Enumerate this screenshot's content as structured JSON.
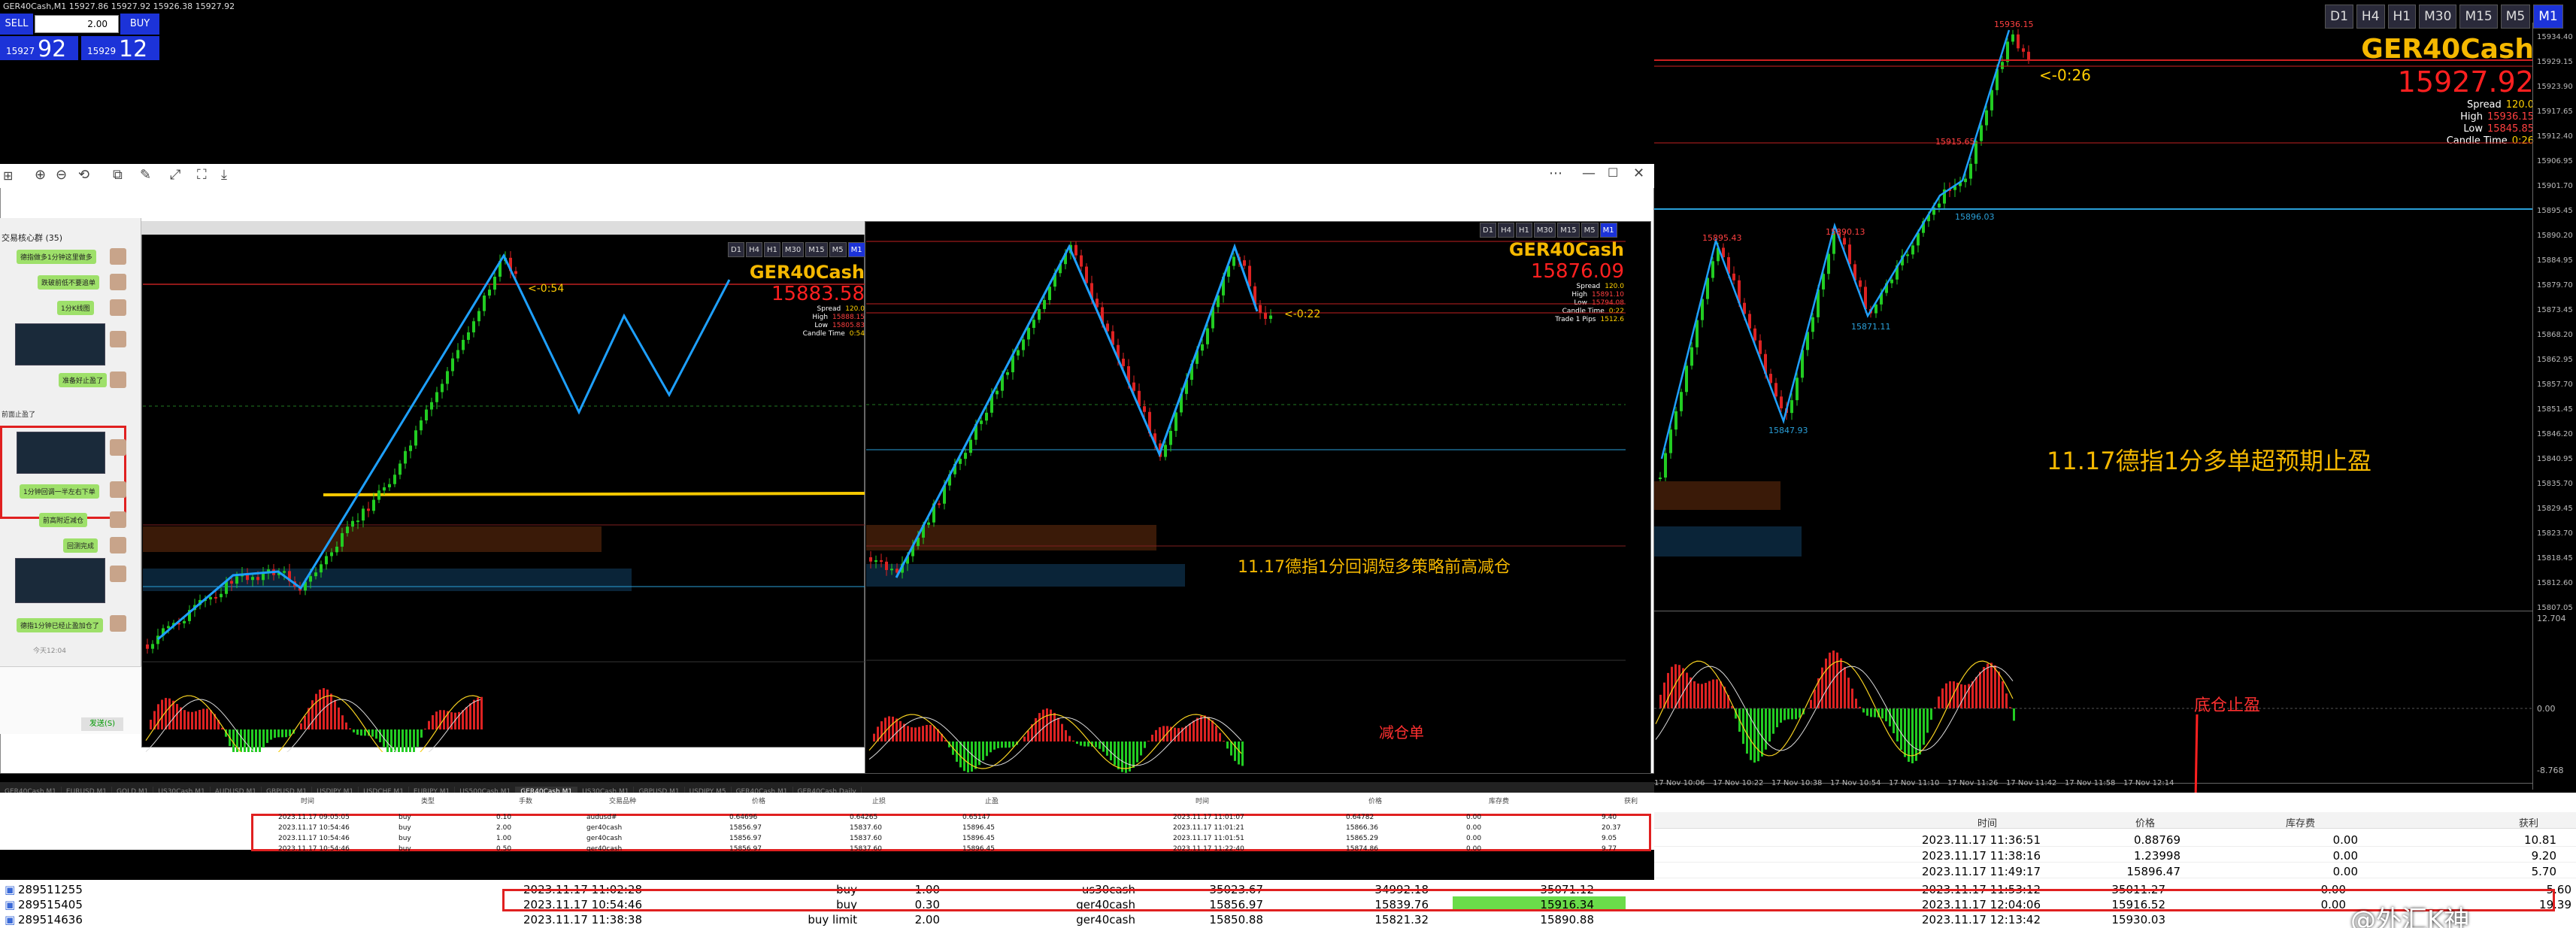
{
  "main_chart": {
    "window_title": "GER40Cash,M1  15927.86 15927.92 15926.38 15927.92",
    "timeframes": [
      "D1",
      "H4",
      "H1",
      "M30",
      "M15",
      "M5",
      "M1"
    ],
    "selected_tf": "M1",
    "symbol": "GER40Cash",
    "price": "15927.92",
    "spread_label": "Spread",
    "spread": "120.0",
    "high_label": "High",
    "high": "15936.15",
    "low_label": "Low",
    "low": "15845.85",
    "candle_label": "Candle Time",
    "candle_time": "0:26",
    "cursor_label": "<-0:26",
    "annotation": "11.17德指1分多单超预期止盈",
    "bottom_note": "底仓止盈",
    "label_peak": "15936.15",
    "label_a": "15895.43",
    "label_b": "15890.13",
    "label_c": "15847.93",
    "label_d": "15871.11",
    "label_e": "15896.03",
    "label_f": "15915.65",
    "y_ticks": [
      "15934.40",
      "15929.15",
      "15923.90",
      "15917.65",
      "15912.40",
      "15906.95",
      "15901.70",
      "15895.45",
      "15890.20",
      "15884.95",
      "15879.70",
      "15873.45",
      "15868.20",
      "15862.95",
      "15857.70",
      "15851.45",
      "15846.20",
      "15840.95",
      "15835.70",
      "15829.45",
      "15823.70",
      "15818.45",
      "15812.60",
      "15807.05"
    ],
    "osc_ticks": [
      "12.704",
      "0.00",
      "-8.768"
    ],
    "x_ticks": [
      "17 Nov 10:06",
      "17 Nov 10:22",
      "17 Nov 10:38",
      "17 Nov 10:54",
      "17 Nov 11:10",
      "17 Nov 11:26",
      "17 Nov 11:42",
      "17 Nov 11:58",
      "17 Nov 12:14"
    ]
  },
  "trade_panel": {
    "sell": "SELL",
    "buy": "BUY",
    "lot": "2.00",
    "sell_small": "15927",
    "sell_big": "92",
    "buy_small": "15929",
    "buy_big": "12"
  },
  "window2": {
    "symbol": "GER40Cash",
    "price": "15883.58",
    "spread": "120.0",
    "high": "15888.15",
    "low": "15805.83",
    "candle": "0:54",
    "cursor": "<-0:54",
    "timeframes": [
      "D1",
      "H4",
      "H1",
      "M30",
      "M15",
      "M5",
      "M1"
    ]
  },
  "window3": {
    "symbol": "GER40Cash",
    "price": "15876.09",
    "spread": "120.0",
    "high": "15891.10",
    "low": "15794.08",
    "candle_time_label": "Candle Time",
    "candle": "0:22",
    "trade_label": "Trade 1 Pips",
    "trade_val": "1512.6",
    "cursor": "<-0:22",
    "annotation": "11.17德指1分回调短多策略前高减仓",
    "note": "减仓单",
    "timeframes": [
      "D1",
      "H4",
      "H1",
      "M30",
      "M15",
      "M5",
      "M1"
    ]
  },
  "chat": {
    "title": "交易核心群 (35)",
    "messages": [
      "德指做多1分钟这里做多",
      "跌破前低不要追单",
      "1分K线图",
      "准备好止盈了",
      "1分钟回调一半左右下单",
      "前高附近减仓",
      "回测完成",
      "德指1分钟已经止盈加仓了"
    ],
    "status": "今天12:04",
    "side_text": "前面止盈了",
    "send": "发送(S)"
  },
  "symbol_tabs": [
    "GER40Cash,M1",
    "EURUSD,M1",
    "GOLD,M1",
    "US30Cash,M1",
    "AUDUSD,M1",
    "GBPUSD,M1",
    "USDJPY,M1",
    "USDCHF,M1",
    "EURJPY,M1",
    "US500Cash,M1",
    "GER40Cash,M1",
    "US30Cash,M1",
    "GBPUSD,M1",
    "USDJPY,M5",
    "GER40Cash,M1",
    "GER40Cash,Daily"
  ],
  "inner_orders": {
    "headers": [
      "时间",
      "类型",
      "手数",
      "交易品种",
      "价格",
      "止损",
      "止盈",
      "时间",
      "价格",
      "库存费",
      "获利"
    ],
    "rows": [
      [
        "2023.11.17 09:05:05",
        "buy",
        "0.10",
        "audusd#",
        "0.64696",
        "0.64265",
        "0.65147",
        "2023.11.17 11:01:07",
        "0.64782",
        "0.00",
        "9.40"
      ],
      [
        "2023.11.17 10:54:46",
        "buy",
        "2.00",
        "ger40cash",
        "15856.97",
        "15837.60",
        "15896.45",
        "2023.11.17 11:01:21",
        "15866.36",
        "0.00",
        "20.37"
      ],
      [
        "2023.11.17 10:54:46",
        "buy",
        "1.00",
        "ger40cash",
        "15856.97",
        "15837.60",
        "15896.45",
        "2023.11.17 11:01:51",
        "15865.29",
        "0.00",
        "9.05"
      ],
      [
        "2023.11.17 10:54:46",
        "buy",
        "0.50",
        "ger40cash",
        "15856.97",
        "15837.60",
        "15896.45",
        "2023.11.17 11:22:40",
        "15874.86",
        "0.00",
        "9.77"
      ]
    ]
  },
  "right_history": {
    "headers": [
      "时间",
      "价格",
      "库存费",
      "获利"
    ],
    "rows": [
      [
        "2023.11.17 11:36:51",
        "0.88769",
        "0.00",
        "10.81"
      ],
      [
        "2023.11.17 11:38:16",
        "1.23998",
        "0.00",
        "9.20"
      ],
      [
        "2023.11.17 11:49:17",
        "15896.47",
        "0.00",
        "5.70"
      ],
      [
        "2023.11.17 11:53:12",
        "35011.27",
        "0.00",
        "5.60"
      ]
    ]
  },
  "bottom_orders": {
    "rows": [
      {
        "id": "289511255",
        "open": "2023.11.17 11:02:28",
        "type": "buy",
        "lots": "1.00",
        "symbol": "us30cash",
        "price": "35023.67",
        "sl": "34992.18",
        "tp": "35071.12",
        "close": "2023.11.17 11:53:12",
        "cprice": "35011.27",
        "swap": "0.00",
        "profit": "5.60"
      },
      {
        "id": "289515405",
        "open": "2023.11.17 10:54:46",
        "type": "buy",
        "lots": "0.30",
        "symbol": "ger40cash",
        "price": "15856.97",
        "sl": "15839.76",
        "tp": "15916.34",
        "close": "2023.11.17 12:04:06",
        "cprice": "15916.52",
        "swap": "0.00",
        "profit": "19.39"
      },
      {
        "id": "289514636",
        "open": "2023.11.17 11:38:38",
        "type": "buy limit",
        "lots": "2.00",
        "symbol": "ger40cash",
        "price": "15850.88",
        "sl": "15821.32",
        "tp": "15890.88",
        "close": "2023.11.17 12:13:42",
        "cprice": "15930.03",
        "swap": "",
        "profit": ""
      }
    ]
  },
  "watermark": "@外汇K神",
  "colors": {
    "accent_blue": "#1c33d8",
    "gold": "#f5b800",
    "red": "#ff2020",
    "bull": "#22cc22",
    "bear": "#dd2222",
    "zigzag": "#1ea0ff"
  }
}
